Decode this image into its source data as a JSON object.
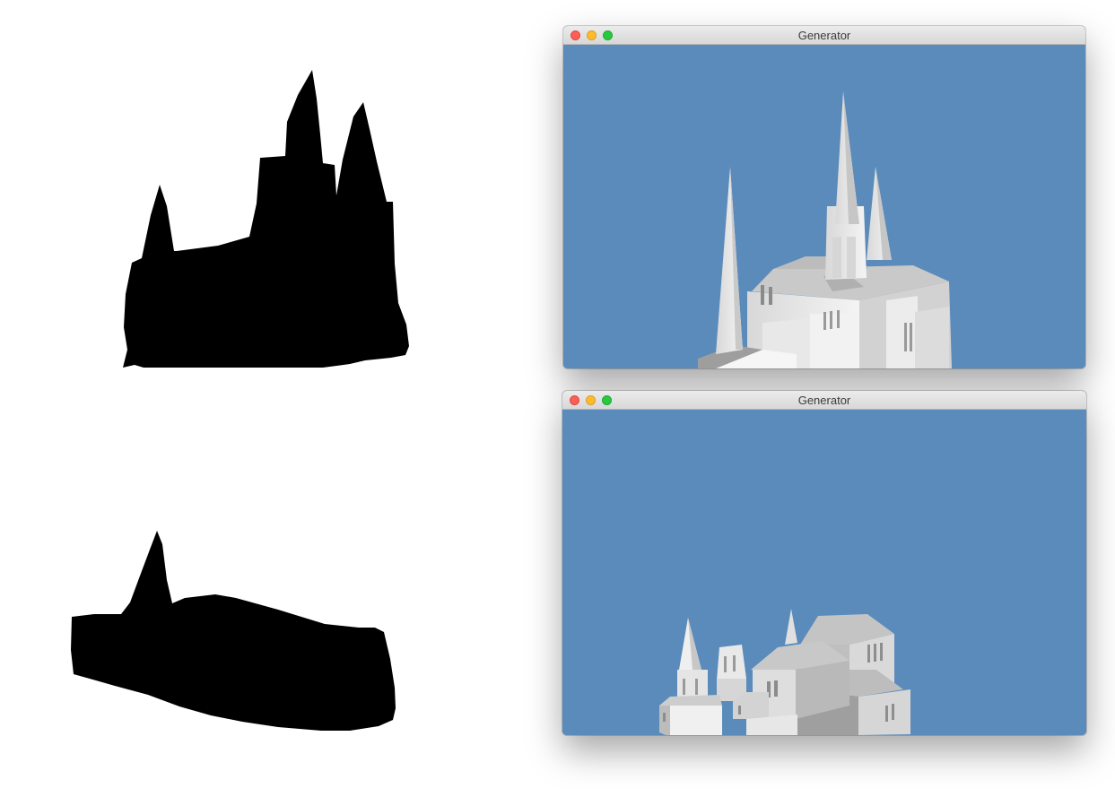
{
  "windows": [
    {
      "title": "Generator",
      "viewport_background": "#5a8bbb",
      "controls": [
        "close-button",
        "minimize-button",
        "zoom-button"
      ]
    },
    {
      "title": "Generator",
      "viewport_background": "#5a8bbb",
      "controls": [
        "close-button",
        "minimize-button",
        "zoom-button"
      ]
    }
  ],
  "colors": {
    "close": "#fc5f57",
    "minimize": "#fdbc2e",
    "zoom": "#28c840",
    "silhouette": "#000000"
  }
}
